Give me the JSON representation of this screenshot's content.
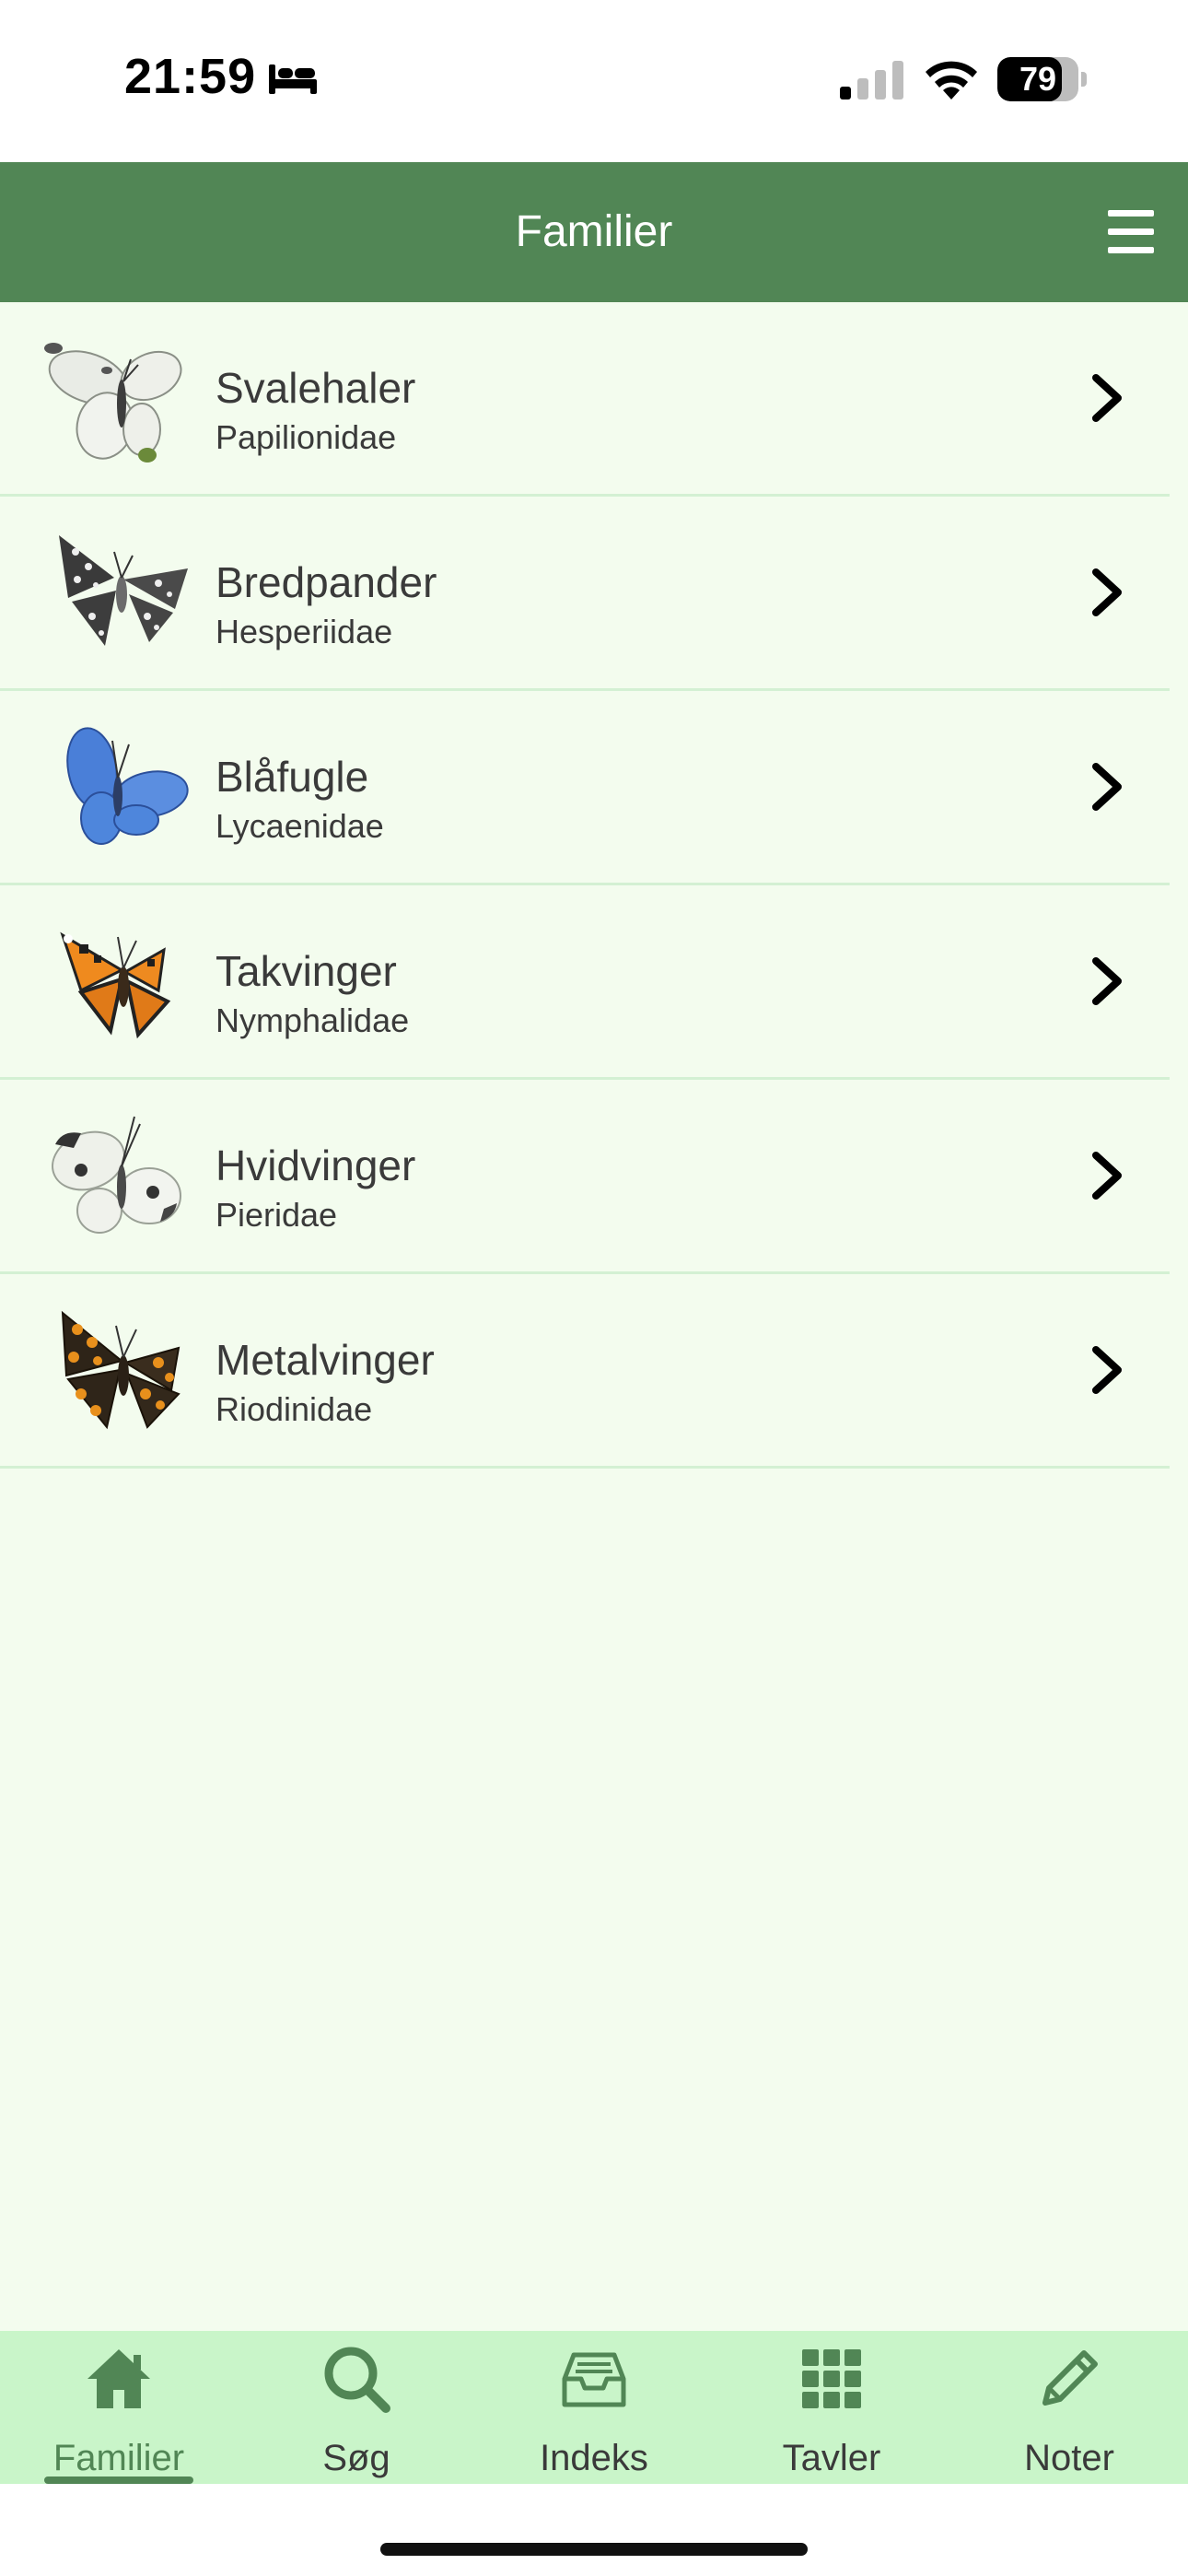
{
  "status_bar": {
    "time": "21:59",
    "battery_level": "79",
    "battery_fraction": 0.79
  },
  "header": {
    "title": "Familier"
  },
  "families": [
    {
      "name": "Svalehaler",
      "latin": "Papilionidae",
      "icon": "white-butterfly"
    },
    {
      "name": "Bredpander",
      "latin": "Hesperiidae",
      "icon": "checkered-skipper"
    },
    {
      "name": "Blåfugle",
      "latin": "Lycaenidae",
      "icon": "blue-butterfly"
    },
    {
      "name": "Takvinger",
      "latin": "Nymphalidae",
      "icon": "tortoiseshell-butterfly"
    },
    {
      "name": "Hvidvinger",
      "latin": "Pieridae",
      "icon": "cabbage-white-butterfly"
    },
    {
      "name": "Metalvinger",
      "latin": "Riodinidae",
      "icon": "fritillary-butterfly"
    }
  ],
  "tabs": [
    {
      "label": "Familier",
      "icon": "home-icon",
      "active": true
    },
    {
      "label": "Søg",
      "icon": "search-icon",
      "active": false
    },
    {
      "label": "Indeks",
      "icon": "inbox-icon",
      "active": false
    },
    {
      "label": "Tavler",
      "icon": "grid-icon",
      "active": false
    },
    {
      "label": "Noter",
      "icon": "pencil-icon",
      "active": false
    }
  ],
  "colors": {
    "header_green": "#518655",
    "list_background": "#f3fcee",
    "tab_bar_background": "#c9f5c9",
    "divider": "#d3f0d3"
  }
}
